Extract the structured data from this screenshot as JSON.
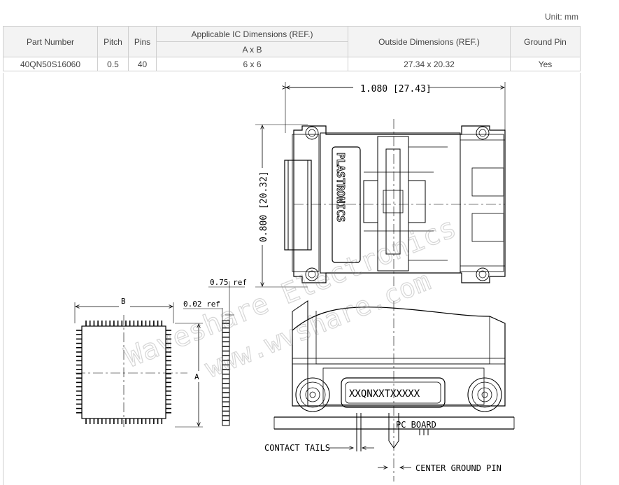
{
  "unit_label": "Unit: mm",
  "table": {
    "headers": {
      "part_number": "Part Number",
      "pitch": "Pitch",
      "pins": "Pins",
      "ic_dimensions": "Applicable IC Dimensions (REF.)",
      "ic_dimensions_sub": "A x B",
      "outside_dimensions": "Outside Dimensions (REF.)",
      "ground_pin": "Ground Pin"
    },
    "row": {
      "part_number": "40QN50S16060",
      "pitch": "0.5",
      "pins": "40",
      "ic_dimensions": "6 x 6",
      "outside_dimensions": "27.34 x 20.32",
      "ground_pin": "Yes"
    }
  },
  "drawing": {
    "width_dim": "1.080 [27.43]",
    "height_dim": "0.800 [20.32]",
    "logo_text": "PLASTRONICS",
    "pitch_ref": "0.75 ref",
    "lead_ref": "0.02 ref",
    "dim_b": "B",
    "dim_a": "A",
    "part_marking": "XXQNXXTXXXXX",
    "pc_board": "PC BOARD",
    "contact_tails": "CONTACT TAILS",
    "center_ground_pin": "CENTER GROUND PIN",
    "watermark_1": "Waveshare Electronics",
    "watermark_2": "www.wvshare.com"
  }
}
